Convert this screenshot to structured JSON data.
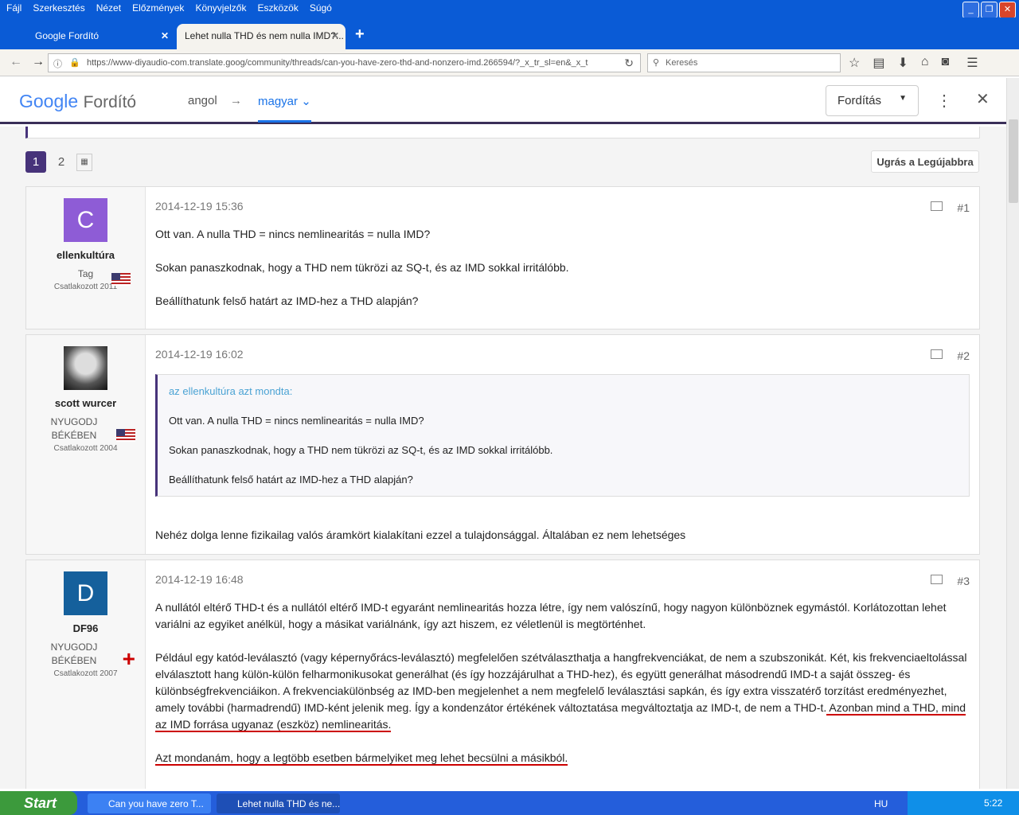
{
  "menu": [
    "Fájl",
    "Szerkesztés",
    "Nézet",
    "Előzmények",
    "Könyvjelzők",
    "Eszközök",
    "Súgó"
  ],
  "tabs": [
    {
      "label": "Google Fordító"
    },
    {
      "label": "Lehet nulla THD és nem nulla IMD?..."
    }
  ],
  "url": "https://www-diyaudio-com.translate.goog/community/threads/can-you-have-zero-thd-and-nonzero-imd.266594/?_x_tr_sl=en&_x_t",
  "search_placeholder": "Keresés",
  "translate": {
    "logo_google": "Google",
    "logo_product": "Fordító",
    "source": "angol",
    "arrow": "→",
    "target": "magyar",
    "button": "Fordítás"
  },
  "pager": {
    "pages": [
      "1",
      "2"
    ],
    "jump": "Ugrás a Legújabbra"
  },
  "posts": [
    {
      "avatar": "C",
      "avatar_color": "#8e5cd6",
      "user": "ellenkultúra",
      "title": "Tag",
      "joined": "Csatlakozott 2011",
      "date": "2014-12-19 15:36",
      "num": "#1",
      "paras": [
        "Ott van. A nulla THD = nincs nemlinearitás = nulla IMD?",
        "Sokan panaszkodnak, hogy a THD nem tükrözi az SQ-t, és az IMD sokkal irritálóbb.",
        "Beállíthatunk felső határt az IMD-hez a THD alapján?"
      ]
    },
    {
      "user": "scott wurcer",
      "title": "NYUGODJ BÉKÉBEN",
      "joined": "Csatlakozott 2004",
      "date": "2014-12-19 16:02",
      "num": "#2",
      "quote_head": "az ellenkultúra azt mondta:",
      "quote": [
        "Ott van. A nulla THD = nincs nemlinearitás = nulla IMD?",
        "Sokan panaszkodnak, hogy a THD nem tükrözi az SQ-t, és az IMD sokkal irritálóbb.",
        "Beállíthatunk felső határt az IMD-hez a THD alapján?"
      ],
      "paras": [
        "Nehéz dolga lenne fizikailag valós áramkört kialakítani ezzel a tulajdonsággal. Általában ez nem lehetséges"
      ]
    },
    {
      "avatar": "D",
      "avatar_color": "#15609c",
      "user": "DF96",
      "title": "NYUGODJ BÉKÉBEN",
      "joined": "Csatlakozott 2007",
      "date": "2014-12-19 16:48",
      "num": "#3",
      "paras": [
        "A nullától eltérő THD-t és a nullától eltérő IMD-t egyaránt nemlinearitás hozza létre, így nem valószínű, hogy nagyon különböznek egymástól. Korlátozottan lehet variálni az egyiket anélkül, hogy a másikat variálnánk, így azt hiszem, ez véletlenül is megtörténhet.",
        "Például egy katód-leválasztó (vagy képernyőrács-leválasztó) megfelelően szétválaszthatja a hangfrekvenciákat, de nem a szubszonikát. Két, kis frekvenciaeltolással elválasztott hang külön-külön felharmonikusokat generálhat (és így hozzájárulhat a THD-hez), és együtt generálhat másodrendű IMD-t a saját összeg- és különbségfrekvenciáikon. A frekvenciakülönbség az IMD-ben megjelenhet a nem megfelelő leválasztási sapkán, és így extra visszatérő torzítást eredményezhet, amely további (harmadrendű) IMD-ként jelenik meg. Így a kondenzátor értékének változtatása megváltoztatja az IMD-t, de nem a THD-t.",
        " Azonban mind a THD, mind az IMD forrása ugyanaz (eszköz) nemlinearitás.",
        "Azt mondanám, hogy a legtöbb esetben bármelyiket meg lehet becsülni a másikból."
      ]
    }
  ],
  "taskbar": {
    "start": "Start",
    "items": [
      "Can you have zero T...",
      "Lehet nulla THD és ne..."
    ],
    "lang": "HU",
    "time": "5:22"
  }
}
